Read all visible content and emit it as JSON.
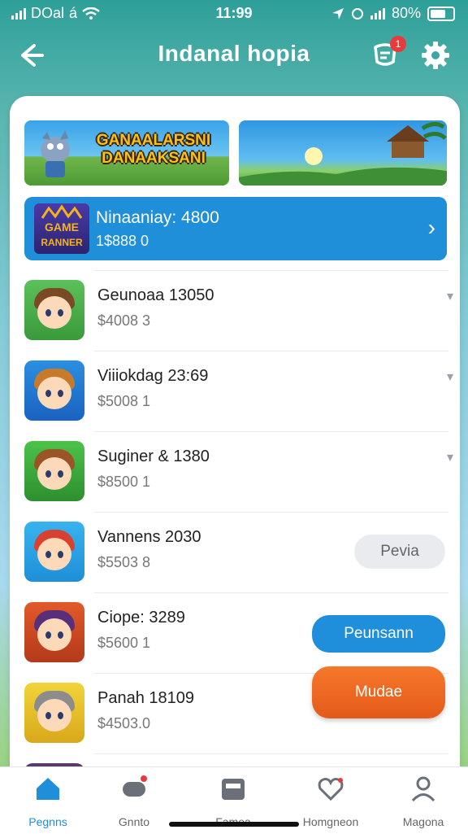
{
  "status_bar": {
    "carrier": "DOal",
    "carrier_mark": "á",
    "time": "11:99",
    "battery": "80%"
  },
  "header": {
    "back_icon": "arrow-left-icon",
    "title": "Indanal hopia",
    "notification_count": "1",
    "settings_icon": "gear-icon"
  },
  "banners": {
    "promo_text": "GANAALARSNI DANAAKSANI"
  },
  "featured": {
    "title": "Ninaaniay: 4800",
    "subtitle": "1$888 0"
  },
  "games": [
    {
      "name": "Geunoaa 13050",
      "price": "$4008 3",
      "action": null
    },
    {
      "name": "Viiiokdag 23:69",
      "price": "$5008 1",
      "action": null
    },
    {
      "name": "Suginer & 1380",
      "price": "$8500 1",
      "action": null
    },
    {
      "name": "Vannens 2030",
      "price": "$5503 8",
      "action": "Pevia"
    },
    {
      "name": "Ciope: 3289",
      "price": "$5600 1",
      "action": "Peunsann"
    },
    {
      "name": "Panah 18109",
      "price": "$4503.0",
      "action": "Mudae"
    }
  ],
  "nav": [
    {
      "label": "Pegnns",
      "icon": "home-icon",
      "active": true
    },
    {
      "label": "Gnnto",
      "icon": "game-controller-icon",
      "active": false
    },
    {
      "label": "Famea",
      "icon": "store-icon",
      "active": false
    },
    {
      "label": "Homgneon",
      "icon": "heart-icon",
      "active": false
    },
    {
      "label": "Magona",
      "icon": "profile-icon",
      "active": false
    }
  ],
  "colors": {
    "accent": "#1e8fd8",
    "orange": "#f26b21",
    "teal": "#2f9f99"
  }
}
